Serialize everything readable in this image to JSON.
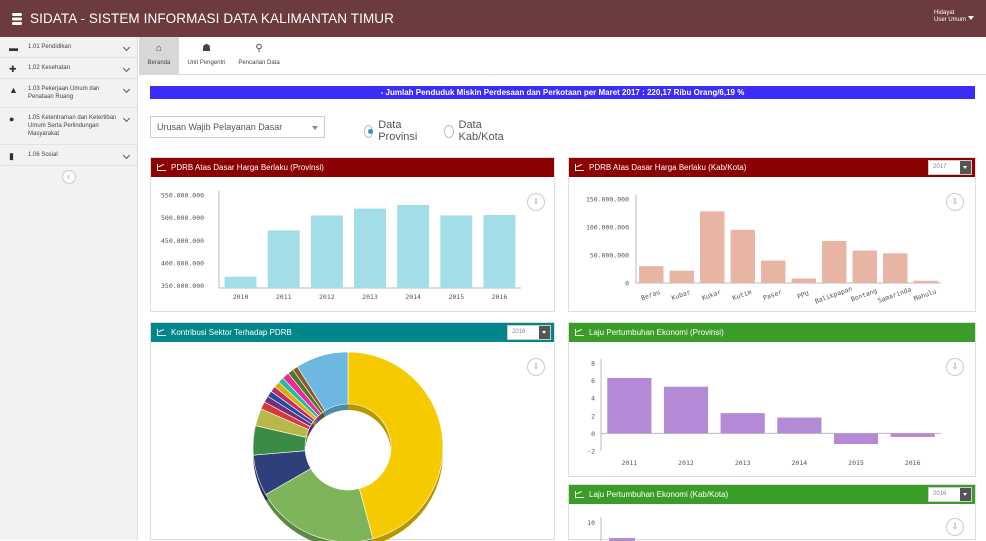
{
  "app": {
    "title": "SIDATA - SISTEM INFORMASI DATA KALIMANTAN TIMUR",
    "user_name": "Hidayat",
    "user_role": "User Umum"
  },
  "sidebar": {
    "items": [
      {
        "label": "1.01 Pendidikan",
        "icon": "graduation-cap-icon",
        "glyph": "▬"
      },
      {
        "label": "1.02 Kesehatan",
        "icon": "medkit-icon",
        "glyph": "✚"
      },
      {
        "label": "1.03 Pekerjaan Umum dan Penataan Ruang",
        "icon": "road-icon",
        "glyph": "▲"
      },
      {
        "label": "1.05 Ketentraman dan Ketertiban Umum Serta Perlindungan Masyarakat",
        "icon": "globe-icon",
        "glyph": "●"
      },
      {
        "label": "1.06 Sosial",
        "icon": "book-icon",
        "glyph": "▮"
      }
    ]
  },
  "tabs": [
    {
      "label": "Beranda",
      "icon": "home-icon",
      "glyph": "⌂",
      "active": true
    },
    {
      "label": "Unit Pengentri",
      "icon": "users-icon",
      "glyph": "☗",
      "active": false
    },
    {
      "label": "Pencarian Data",
      "icon": "search-icon",
      "glyph": "⚲",
      "active": false
    }
  ],
  "marquee": "- Jumlah Penduduk Miskin Perdesaan dan Perkotaan per Maret 2017 : 220,17 Ribu Orang/6,19 %",
  "filters": {
    "select_value": "Urusan Wajib Pelayanan Dasar",
    "radio_provinsi": "Data Provinsi",
    "radio_kabkota": "Data Kab/Kota"
  },
  "panels": {
    "pdrb_prov": {
      "title": "PDRB Atas Dasar Harga Berlaku (Provinsi)"
    },
    "pdrb_kab": {
      "title": "PDRB Atas Dasar Harga Berlaku (Kab/Kota)",
      "year": "2017"
    },
    "kontribusi": {
      "title": "Kontribusi Sektor Terhadap PDRB",
      "year": "2016"
    },
    "laju_prov": {
      "title": "Laju Pertumbuhan Ekonomi (Provinsi)"
    },
    "laju_kab": {
      "title": "Laju Pertumbuhan Ekonomi (Kab/Kota)",
      "year": "2016"
    }
  },
  "colors": {
    "topbar": "#6b3b3e",
    "marquee": "#3b2cf7",
    "red_head": "#8b0000",
    "teal_head": "#00868b",
    "green_head": "#3a9d28"
  },
  "chart_data": [
    {
      "id": "pdrb_prov",
      "type": "bar",
      "categories": [
        "2010",
        "2011",
        "2012",
        "2013",
        "2014",
        "2015",
        "2016"
      ],
      "values": [
        370000000,
        472000000,
        505000000,
        520000000,
        528000000,
        505000000,
        506000000
      ],
      "yticks": [
        "550.000.000",
        "500.000.000",
        "450.000.000",
        "400.000.000",
        "350.000.000"
      ],
      "ylim": [
        345000000,
        550000000
      ],
      "color": "#a3dde8"
    },
    {
      "id": "pdrb_kab",
      "type": "bar",
      "categories": [
        "Berau",
        "Kubar",
        "Kukar",
        "Kutim",
        "Paser",
        "PPU",
        "Balikpapan",
        "Bontang",
        "Samarinda",
        "Mahulu"
      ],
      "values": [
        30000000,
        22000000,
        128000000,
        95000000,
        40000000,
        8000000,
        75000000,
        58000000,
        53000000,
        4000000
      ],
      "yticks": [
        "150.000.000",
        "100.000.000",
        "50.000.000",
        "0"
      ],
      "ylim": [
        0,
        150000000
      ],
      "color": "#e8b4a4"
    },
    {
      "id": "kontribusi",
      "type": "pie",
      "slices": [
        {
          "value": 46,
          "color": "#f5cb00"
        },
        {
          "value": 21,
          "color": "#7fb55a"
        },
        {
          "value": 7,
          "color": "#2e3f7a"
        },
        {
          "value": 5,
          "color": "#3a8b43"
        },
        {
          "value": 3,
          "color": "#b8b84a"
        },
        {
          "value": 1.3,
          "color": "#d43a3a"
        },
        {
          "value": 1.1,
          "color": "#7a2a7a"
        },
        {
          "value": 1,
          "color": "#1f4e9a"
        },
        {
          "value": 1,
          "color": "#c42a6a"
        },
        {
          "value": 1,
          "color": "#d8b000"
        },
        {
          "value": 1,
          "color": "#2ab8a8"
        },
        {
          "value": 1.2,
          "color": "#e82a9a"
        },
        {
          "value": 1,
          "color": "#4a7a2a"
        },
        {
          "value": 0.9,
          "color": "#8a5a2a"
        },
        {
          "value": 9,
          "color": "#6cb8e0"
        }
      ]
    },
    {
      "id": "laju_prov",
      "type": "bar",
      "categories": [
        "2011",
        "2012",
        "2013",
        "2014",
        "2015",
        "2016"
      ],
      "values": [
        6.3,
        5.3,
        2.3,
        1.8,
        -1.2,
        -0.4
      ],
      "yticks": [
        "8",
        "6",
        "4",
        "2",
        "0",
        "-2"
      ],
      "ylim": [
        -2,
        8
      ],
      "color": "#b48ad6"
    },
    {
      "id": "laju_kab",
      "type": "bar",
      "yticks": [
        "10"
      ],
      "color": "#b48ad6"
    }
  ]
}
